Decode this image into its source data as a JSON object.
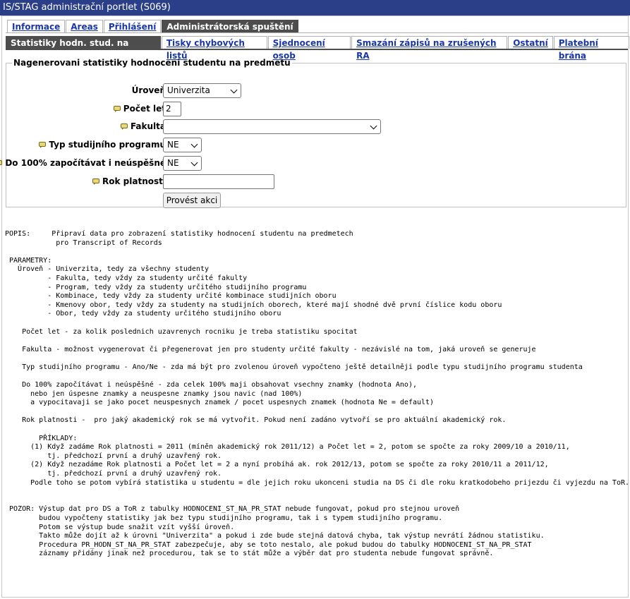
{
  "window": {
    "title": "IS/STAG administrační portlet (S069)"
  },
  "tabs_top": [
    {
      "label": "Informace",
      "active": false
    },
    {
      "label": "Areas",
      "active": false
    },
    {
      "label": "Přihlášení",
      "active": false
    },
    {
      "label": "Administrátorská spuštění",
      "active": true
    }
  ],
  "tabs_sub": [
    {
      "label": "Statistiky hodn. stud. na předm.",
      "active": true
    },
    {
      "label": "Tisky chybových listů",
      "active": false
    },
    {
      "label": "Sjednocení osob",
      "active": false
    },
    {
      "label": "Smazání zápisů na zrušených RA",
      "active": false
    },
    {
      "label": "Ostatní",
      "active": false
    },
    {
      "label": "Platební brána",
      "active": false
    }
  ],
  "form": {
    "legend": "Nagenerovani statistiky hodnoceni studentu na predmetu",
    "uroven": {
      "label": "Úroveň",
      "value": "Univerzita"
    },
    "pocet_let": {
      "label": "Počet let",
      "value": "2"
    },
    "fakulta": {
      "label": "Fakulta",
      "value": ""
    },
    "typ": {
      "label": "Typ studijního programu",
      "value": "NE"
    },
    "do100": {
      "label": "Do 100% započítávat i neúspěšné",
      "value": "NE"
    },
    "rok": {
      "label": "Rok platnosti",
      "value": ""
    },
    "submit_label": "Provést akci"
  },
  "description": "POPIS:     Připraví data pro zobrazení statistiky hodnocení studentu na predmetech\n            pro Transcript of Records\n\n PARAMETRY:\n   Úroveň - Univerzita, tedy za všechny studenty\n          - Fakulta, tedy vždy za studenty určité fakulty\n          - Program, tedy vždy za studenty určitého studijního programu\n          - Kombinace, tedy vždy za studenty určité kombinace studijních oboru\n          - Kmenovy obor, tedy vždy za studenty na studijních oborech, které mají shodné dvě první číslice kodu oboru\n          - Obor, tedy vždy za studenty určitého studijního oboru\n\n    Počet let - za kolik poslednich uzavrenych rocniku je treba statistiku spocitat\n\n    Fakulta - možnost vygenerovat či přegenerovat jen pro studenty určité fakulty - nezávislé na tom, jaká uroveň se generuje\n\n    Typ studijního programu - Ano/Ne - zda má být pro zvolenou úroveň vypočteno ještě detailněji podle typu studijního programu studenta\n\n    Do 100% započítávat i neúspěšné - zda celek 100% maji obsahovat vsechny znamky (hodnota Ano),\n      nebo jen úspesne znamky a neuspesne znamky jsou navic (nad 100%)\n      a vypocitavaji se jako pocet neuspesnych znamek / pocet uspesnych znamek (hodnota Ne = default)\n\n    Rok platnosti -  pro jaký akademický rok se má vytvořit. Pokud není zadáno vytvoří se pro aktuální akademický rok.\n\n        PŘÍKLADY:\n      (1) Když zadáme Rok platnosti = 2011 (míněn akademický rok 2011/12) a Počet let = 2, potom se spočte za roky 2009/10 a 2010/11,\n          tj. předchozí první a druhý uzavřený rok.\n      (2) Když nezadáme Rok platnosti a Počet let = 2 a nyní probíhá ak. rok 2012/13, potom se spočte za roky 2010/11 a 2011/12,\n          tj. předchozí první a druhý uzavřený rok.\n      Podle toho se potom vybírá statistika u studentu = dle jejich roku ukonceni studia na DS či dle roku kratkodobeho prijezdu či vyjezdu na ToR.\n\n\n POZOR: Výstup dat pro DS a ToR z tabulky HODNOCENI_ST_NA_PR_STAT nebude fungovat, pokud pro stejnou uroveň\n        budou vypočteny statistiky jak bez typu studijního programu, tak i s typem studijního programu.\n        Potom se výstup bude snažit vzít vyšší úroveň.\n        Takto může dojít až k úrovni \"Univerzita\" a pokud i zde bude stejná datová chyba, tak výstup nevrátí žádnou statistiku.\n        Procedura PR_HODN_ST_NA_PR_STAT zabezpečuje, aby se toto nestalo, ale pokud budou do tabulky HODNOCENI_ST_NA_PR_STAT\n        záznamy přidány jinak než procedurou, tak se to stát může a výběr dat pro studenta nebude fungovat správně."
}
